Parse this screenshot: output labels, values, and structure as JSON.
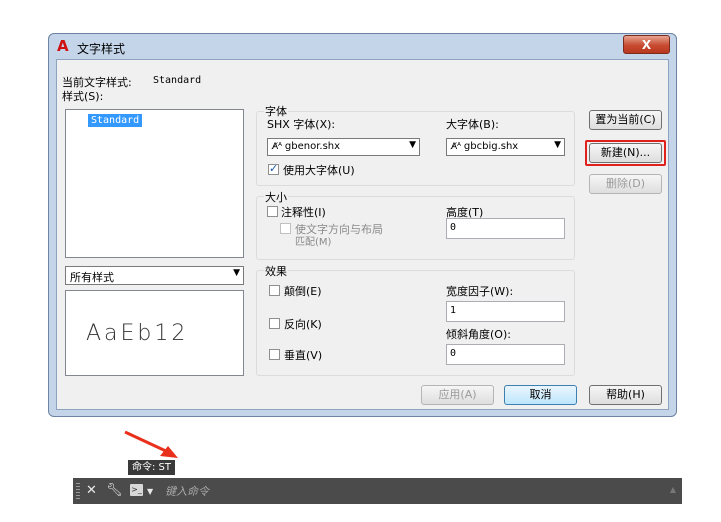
{
  "dialog": {
    "title": "文字样式",
    "close_label": "X",
    "current_style_label": "当前文字样式:",
    "current_style_value": "Standard",
    "styles_label": "样式(S):",
    "styles_list": [
      "Standard"
    ],
    "filter_value": "所有样式",
    "preview_text": "AaEb12",
    "font_group": {
      "label": "字体",
      "shx_label": "SHX 字体(X):",
      "shx_value": "gbenor.shx",
      "bigfont_label": "大字体(B):",
      "bigfont_value": "gbcbig.shx",
      "use_bigfont_label": "使用大字体(U)",
      "use_bigfont_checked": true
    },
    "size_group": {
      "label": "大小",
      "annotative_label": "注释性(I)",
      "annotative_checked": false,
      "match_orientation_line1": "使文字方向与布局",
      "match_orientation_line2": "匹配(M)",
      "height_label": "高度(T)",
      "height_value": "0"
    },
    "effects_group": {
      "label": "效果",
      "upside_down_label": "颠倒(E)",
      "backwards_label": "反向(K)",
      "vertical_label": "垂直(V)",
      "width_factor_label": "宽度因子(W):",
      "width_factor_value": "1",
      "oblique_label": "倾斜角度(O):",
      "oblique_value": "0"
    },
    "buttons": {
      "set_current": "置为当前(C)",
      "new": "新建(N)...",
      "delete": "删除(D)",
      "apply": "应用(A)",
      "cancel": "取消",
      "help": "帮助(H)"
    }
  },
  "command": {
    "tooltip": "命令: ST",
    "placeholder": "键入命令",
    "close_icon": "close-icon",
    "settings_icon": "wrench-icon",
    "prompt_icon": "prompt-icon"
  },
  "colors": {
    "accent_selection": "#3399ff",
    "highlight_red": "#e0201c",
    "title_bar": "#c4d5ea",
    "command_bar": "#4b4b4b"
  }
}
